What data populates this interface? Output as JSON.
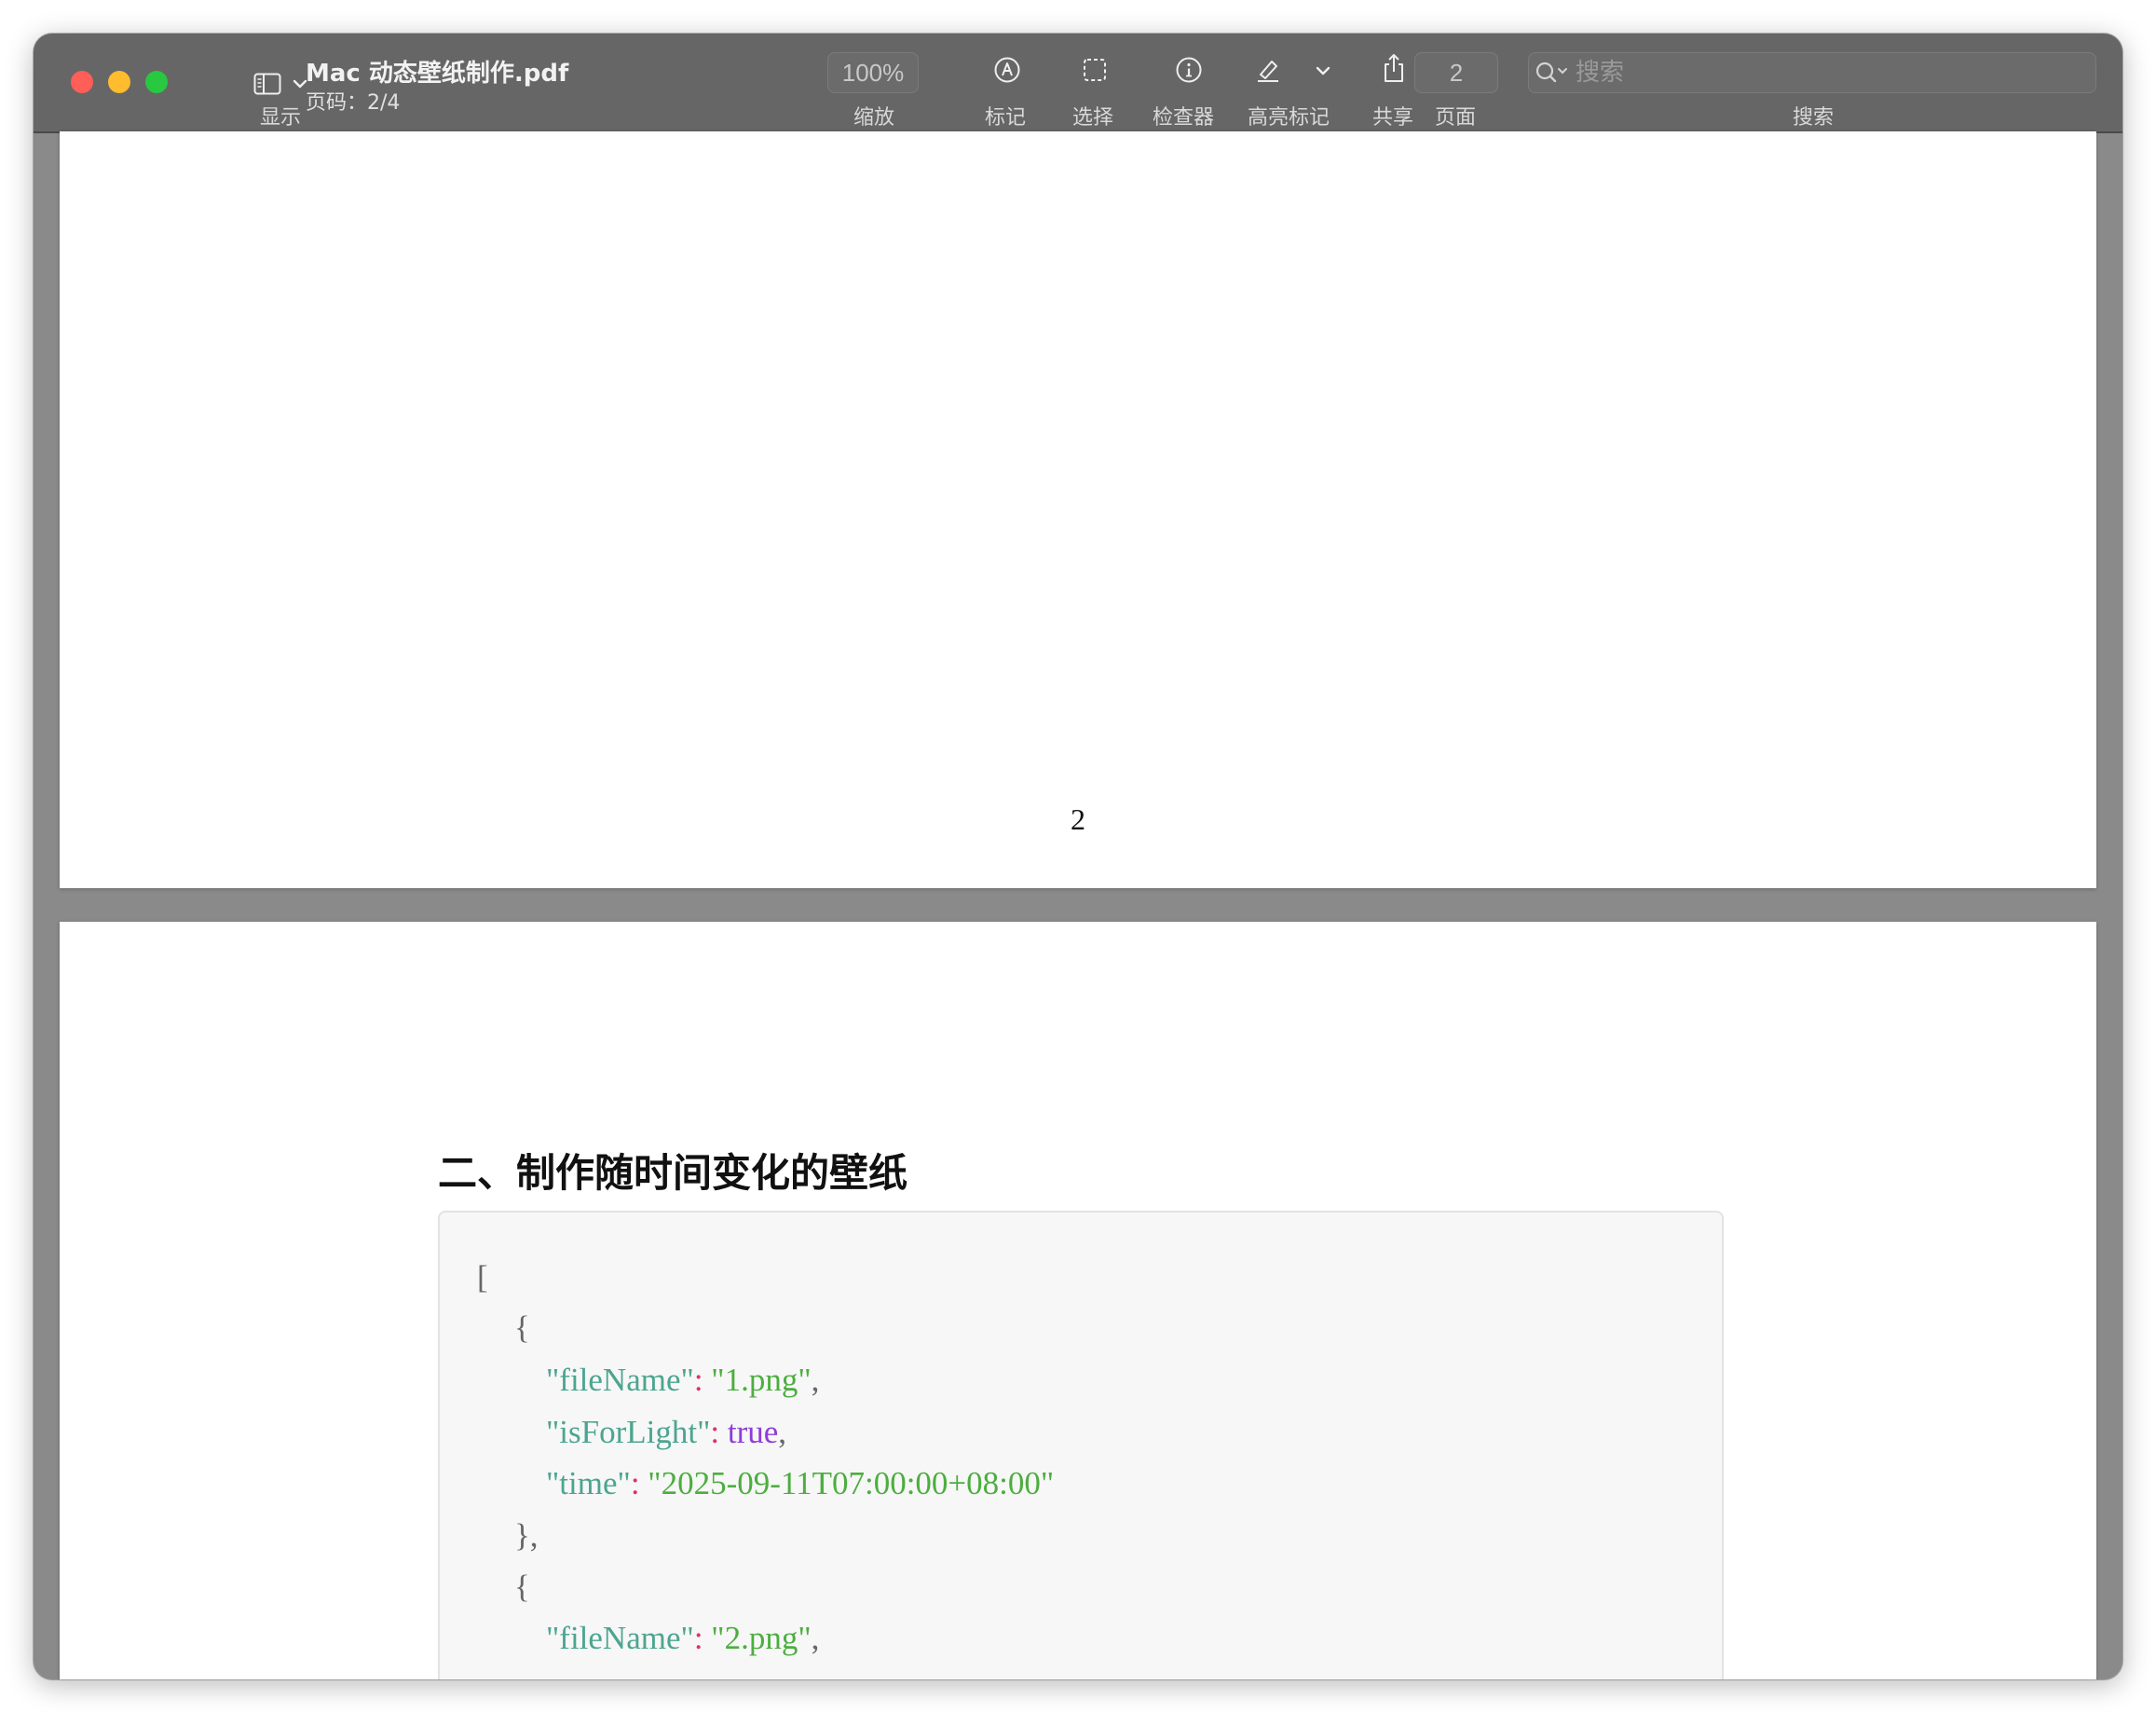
{
  "window": {
    "title": "Mac 动态壁纸制作.pdf",
    "subtitle": "页码：2/4"
  },
  "toolbar": {
    "display_label": "显示",
    "zoom_value": "100%",
    "zoom_label": "缩放",
    "markup_label": "标记",
    "select_label": "选择",
    "inspector_label": "检查器",
    "highlight_label": "高亮标记",
    "share_label": "共享",
    "page_value": "2",
    "page_label": "页面",
    "search_placeholder": "搜索",
    "search_label": "搜索"
  },
  "icons": {
    "sidebar": "sidebar-icon",
    "chevron": "chevron-down-icon",
    "markup": "pen-circle-icon",
    "select": "dashed-rect-icon",
    "inspector": "info-icon",
    "highlight": "highlighter-icon",
    "share": "share-icon",
    "search": "magnifier-icon"
  },
  "colors": {
    "close": "#ff5f57",
    "minimize": "#febc2e",
    "zoom": "#28c840",
    "json_key": "#4ca590",
    "json_colon": "#e0306a",
    "json_string": "#4cae3f",
    "json_bool": "#8e3ed6"
  },
  "document": {
    "page1_number": "2",
    "section_heading": "二、制作随时间变化的壁纸",
    "code": {
      "open_bracket": "[",
      "open_brace": "{",
      "close_brace_comma": "},",
      "q": "\"",
      "colon": ":",
      "comma": ",",
      "obj1": {
        "key1": "fileName",
        "val1": "1.png",
        "key2": "isForLight",
        "val2": "true",
        "key3": "time",
        "val3": "2025-09-11T07:00:00+08:00"
      },
      "obj2": {
        "key1": "fileName",
        "val1": "2.png"
      }
    }
  }
}
